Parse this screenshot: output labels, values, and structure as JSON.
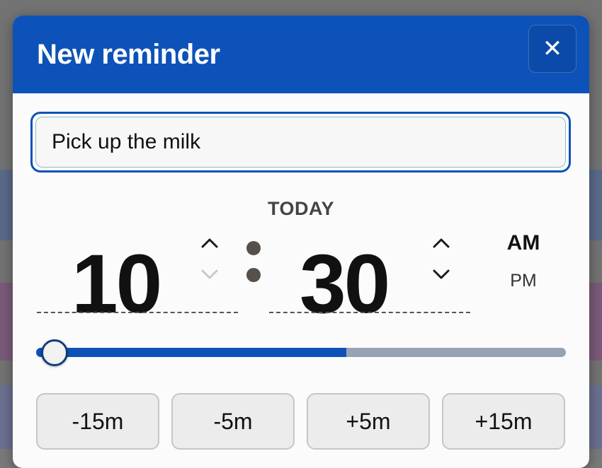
{
  "dialog": {
    "title": "New reminder",
    "close_glyph": "✕"
  },
  "reminder": {
    "text_value": "Pick up the milk"
  },
  "schedule": {
    "day_label": "TODAY",
    "hours": "10",
    "minutes": "30",
    "am_label": "AM",
    "pm_label": "PM",
    "selected_period": "AM",
    "up_glyph": "⌃",
    "down_glyph": "⌄",
    "slider_fraction": 0.585
  },
  "quick_adjust": [
    {
      "label": "-15m"
    },
    {
      "label": "-5m"
    },
    {
      "label": "+5m"
    },
    {
      "label": "+15m"
    }
  ],
  "colors": {
    "accent": "#0d52b8",
    "track": "#97a3b4"
  }
}
